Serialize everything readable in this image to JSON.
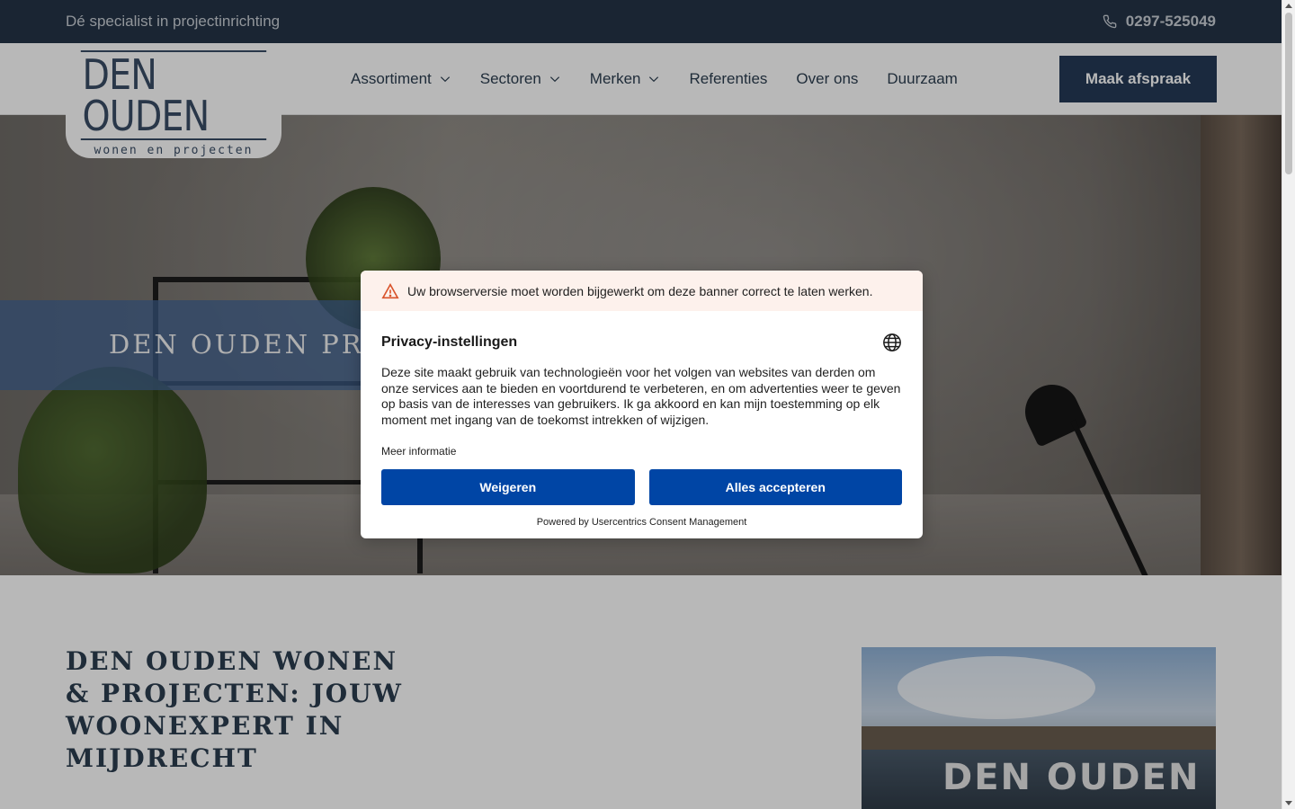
{
  "topbar": {
    "tagline": "Dé specialist in projectinrichting",
    "phone": "0297-525049",
    "phone_icon": "phone-icon"
  },
  "logo": {
    "main": "DEN OUDEN",
    "sub": "wonen en projecten"
  },
  "nav": {
    "items": [
      {
        "label": "Assortiment",
        "has_dropdown": true
      },
      {
        "label": "Sectoren",
        "has_dropdown": true
      },
      {
        "label": "Merken",
        "has_dropdown": true
      },
      {
        "label": "Referenties",
        "has_dropdown": false
      },
      {
        "label": "Over ons",
        "has_dropdown": false
      },
      {
        "label": "Duurzaam",
        "has_dropdown": false
      }
    ],
    "cta": "Maak afspraak"
  },
  "hero": {
    "title": "DEN OUDEN PROJ"
  },
  "intro": {
    "title": "DEN OUDEN WONEN & PROJECTEN: JOUW WOONEXPERT IN MIJDRECHT",
    "store_sign": "DEN OUDEN"
  },
  "consent": {
    "warning": "Uw browserversie moet worden bijgewerkt om deze banner correct te laten werken.",
    "title": "Privacy-instellingen",
    "text": "Deze site maakt gebruik van technologieën voor het volgen van websites van derden om onze services aan te bieden en voortdurend te verbeteren, en om advertenties weer te geven op basis van de interesses van gebruikers. Ik ga akkoord en kan mijn toestemming op elk moment met ingang van de toekomst intrekken of wijzigen.",
    "more_info": "Meer informatie",
    "deny": "Weigeren",
    "accept": "Alles accepteren",
    "powered_by": "Powered by Usercentrics Consent Management"
  },
  "colors": {
    "topbar": "#243447",
    "cta": "#243a57",
    "consent_button": "#0045a5",
    "warning_bg": "#fdf1ec"
  }
}
